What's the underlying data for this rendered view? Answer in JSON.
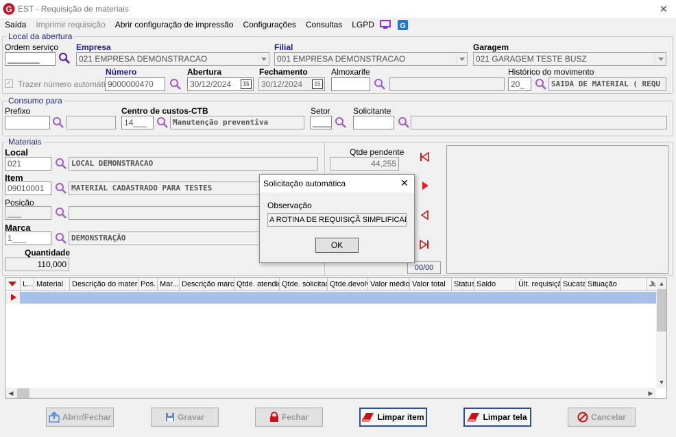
{
  "window": {
    "title": "EST - Requisição de materiais",
    "close": "✕"
  },
  "menu": {
    "saida": "Saída",
    "imprimir": "Imprimir requisição",
    "abrir_conf": "Abrir configuração de impressão",
    "configuracoes": "Configurações",
    "consultas": "Consultas",
    "lgpd": "LGPD"
  },
  "abertura_group": {
    "title": "Local da abertura",
    "ordem_label": "Ordem serviço",
    "ordem_value": "_______",
    "empresa_label": "Empresa",
    "empresa_value": "021 EMPRESA DEMONSTRACAO",
    "filial_label": "Filial",
    "filial_value": "001 EMPRESA DEMONSTRACAO",
    "garagem_label": "Garagem",
    "garagem_value": "021 GARAGEM TESTE BUSZ",
    "trazer_label": "Trazer número automático",
    "numero_label": "Número",
    "numero_value": "9000000470",
    "abertura_label": "Abertura",
    "abertura_value": "30/12/2024",
    "fechamento_label": "Fechamento",
    "fechamento_value": "30/12/2024",
    "almox_label": "Almoxarife",
    "almox_value": "",
    "hist_label": "Histórico do movimento",
    "hist_code": "20_",
    "hist_value": "SAIDA DE MATERIAL ( REQU",
    "cal_icon": "15"
  },
  "consumo_group": {
    "title": "Consumo para",
    "prefixo_label": "Prefixo",
    "prefixo_value": "",
    "cc_label": "Centro de custos-CTB",
    "cc_code": "14___",
    "cc_value": "Manutenção preventiva",
    "setor_label": "Setor",
    "setor_value": "____",
    "solic_label": "Solicitante",
    "solic_value": ""
  },
  "materiais_group": {
    "title": "Materiais",
    "local_label": "Local",
    "local_code": "021",
    "local_value": "LOCAL DEMONSTRACAO",
    "item_label": "Item",
    "item_code": "09010001",
    "item_value": "MATERIAL CADASTRADO PARA TESTES",
    "posicao_label": "Posição",
    "posicao_code": "___",
    "marca_label": "Marca",
    "marca_code": "1___",
    "marca_value": "DEMONSTRAÇÃO",
    "qtd_label": "Quantidade",
    "qtd_value": "110,000",
    "pend_label": "Qtde pendente",
    "pend_value": "44,255",
    "nav_count": "00/00"
  },
  "grid": {
    "columns": [
      "L...",
      "Material",
      "Descrição do material",
      "Pos.",
      "Mar...",
      "Descrição marca",
      "Qtde. atendida",
      "Qtde. solicitada",
      "Qtde.devolv.",
      "Valor médio",
      "Valor total",
      "Status",
      "Saldo",
      "Últ. requisição",
      "Sucata",
      "Situação",
      "Ju"
    ]
  },
  "dialog": {
    "title": "Solicitação automática",
    "close": "✕",
    "obs_label": "Observação",
    "obs_value": "A ROTINA DE REQUISIÇÃ SIMPLIFICADA",
    "ok": "OK"
  },
  "buttons": {
    "abrir": "Abrir/Fechar",
    "gravar": "Gravar",
    "fechar": "Fechar",
    "limpar_item": "Limpar item",
    "limpar_tela": "Limpar tela",
    "cancelar": "Cancelar"
  },
  "colors": {
    "accent": "#1a1a8c",
    "icon_purple": "#8a2be2",
    "nav_red": "#d01010",
    "selection": "#a8bfe6"
  }
}
